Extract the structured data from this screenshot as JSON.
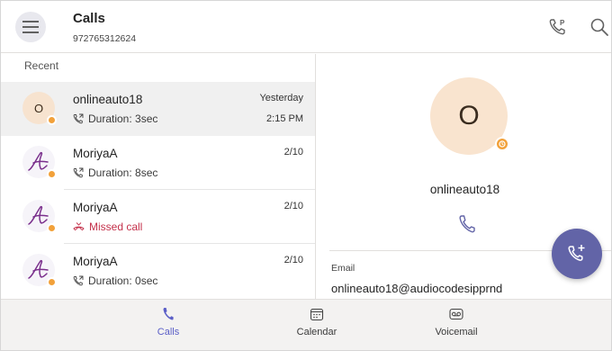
{
  "header": {
    "title": "Calls",
    "subtitle": "972765312624",
    "icons": [
      "menu-icon",
      "park-call-icon",
      "search-icon"
    ]
  },
  "list": {
    "section_label": "Recent",
    "items": [
      {
        "avatar_text": "O",
        "name": "onlineauto18",
        "detail": "Duration: 3sec",
        "date": "Yesterday",
        "time": "2:15 PM",
        "type": "outgoing",
        "selected": true
      },
      {
        "avatar_text": "",
        "name": "MoriyaA",
        "detail": "Duration: 8sec",
        "date": "2/10",
        "time": "",
        "type": "outgoing",
        "selected": false
      },
      {
        "avatar_text": "",
        "name": "MoriyaA",
        "detail": "Missed call",
        "date": "2/10",
        "time": "",
        "type": "missed",
        "selected": false
      },
      {
        "avatar_text": "",
        "name": "MoriyaA",
        "detail": "Duration: 0sec",
        "date": "2/10",
        "time": "",
        "type": "outgoing",
        "selected": false
      }
    ]
  },
  "detail": {
    "avatar_text": "O",
    "name": "onlineauto18",
    "email_label": "Email",
    "email": "onlineauto18@audiocodesipprnd"
  },
  "nav": [
    {
      "label": "Calls",
      "icon": "phone-icon",
      "active": true
    },
    {
      "label": "Calendar",
      "icon": "calendar-icon",
      "active": false
    },
    {
      "label": "Voicemail",
      "icon": "voicemail-icon",
      "active": false
    }
  ],
  "colors": {
    "accent": "#6264a7",
    "active_nav": "#5b5fc7",
    "presence_away": "#f2a13a",
    "missed": "#c4314b",
    "avatar_bg": "#f9e4cf"
  }
}
